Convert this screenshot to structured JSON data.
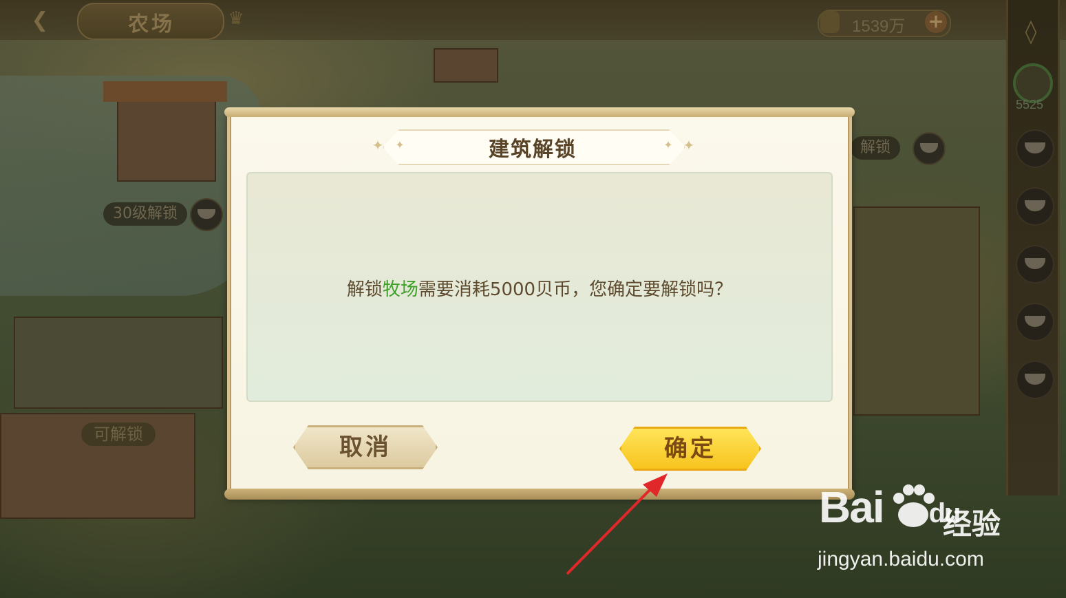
{
  "hud": {
    "back_icon": "chevron-left-icon",
    "title": "农场",
    "currency_value": "1539万",
    "plus_label": "+",
    "rail_progress_value": "5525"
  },
  "map_labels": {
    "lock_30": "30级解锁",
    "right_lock": "解锁",
    "unlockable": "可解锁"
  },
  "dialog": {
    "title": "建筑解锁",
    "message_prefix": "解锁",
    "message_highlight": "牧场",
    "message_suffix": "需要消耗5000贝币，您确定要解锁吗？",
    "cancel_label": "取消",
    "confirm_label": "确定"
  },
  "watermark": {
    "brand": "Bai",
    "brand_tail": "du",
    "cn": "经验",
    "url": "jingyan.baidu.com"
  },
  "colors": {
    "highlight": "#3fa02a",
    "confirm": "#f7c21c",
    "annotation_arrow": "#e0282a"
  }
}
